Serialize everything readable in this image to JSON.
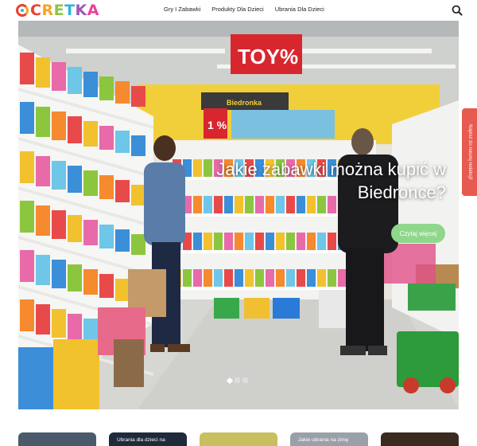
{
  "header": {
    "logo_text": "CRETKA",
    "nav": [
      "Gry I Zabawki",
      "Produkty Dla Dzieci",
      "Ubrania Dla Dzieci"
    ],
    "search_icon": "search-icon"
  },
  "hero": {
    "sign_text": "TOY%",
    "store_sign": "Biedronka",
    "price_sign": "1 %",
    "title": "Jakie zabawki można kupić w Biedronce?",
    "button_label": "Czytaj więcej",
    "slides": 3,
    "active_slide": 1
  },
  "side_tab": {
    "label": "Napisz do naszej redakcji!"
  },
  "thumbnails": [
    {
      "text": "",
      "color": "#4a5a6a"
    },
    {
      "text": "Ubrania dla dzieci na",
      "color": "#1f2a3a"
    },
    {
      "text": "",
      "color": "#c8c060"
    },
    {
      "text": "Jakie ubrania na zimę",
      "color": "#9aa0a8"
    },
    {
      "text": "",
      "color": "#3a2a20"
    }
  ],
  "colors": {
    "logo_c": "#e8412f",
    "logo_r": "#f5a623",
    "logo_e": "#8cc63f",
    "logo_t": "#2fb3e0",
    "logo_k": "#9b59b6",
    "logo_a": "#e84393",
    "button": "#8fd78c",
    "side_tab": "#e85a4f"
  }
}
